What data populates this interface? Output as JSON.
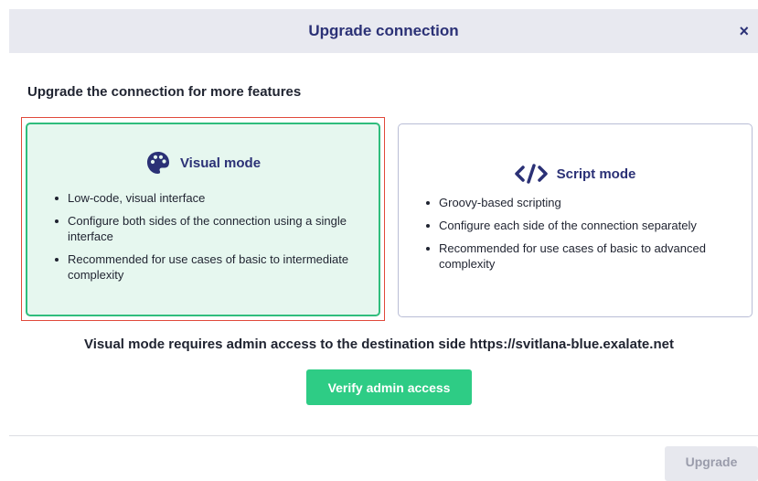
{
  "dialog": {
    "title": "Upgrade connection",
    "close_label": "×",
    "subtitle": "Upgrade the connection for more features"
  },
  "modes": {
    "visual": {
      "title": "Visual mode",
      "icon": "palette-icon",
      "selected": true,
      "items": [
        "Low-code, visual interface",
        "Configure both sides of the connection using a single interface",
        "Recommended for use cases of basic to intermediate complexity"
      ]
    },
    "script": {
      "title": "Script mode",
      "icon": "code-icon",
      "selected": false,
      "items": [
        "Groovy-based scripting",
        "Configure each side of the connection separately",
        "Recommended for use cases of basic to advanced complexity"
      ]
    }
  },
  "notice": "Visual mode requires admin access to the destination side https://svitlana-blue.exalate.net",
  "actions": {
    "verify_label": "Verify admin access",
    "upgrade_label": "Upgrade",
    "upgrade_disabled": true
  },
  "colors": {
    "accent": "#2ecc85",
    "title": "#2b3176",
    "selected_bg": "#e6f7ef",
    "selection_outline": "#e0493b"
  }
}
